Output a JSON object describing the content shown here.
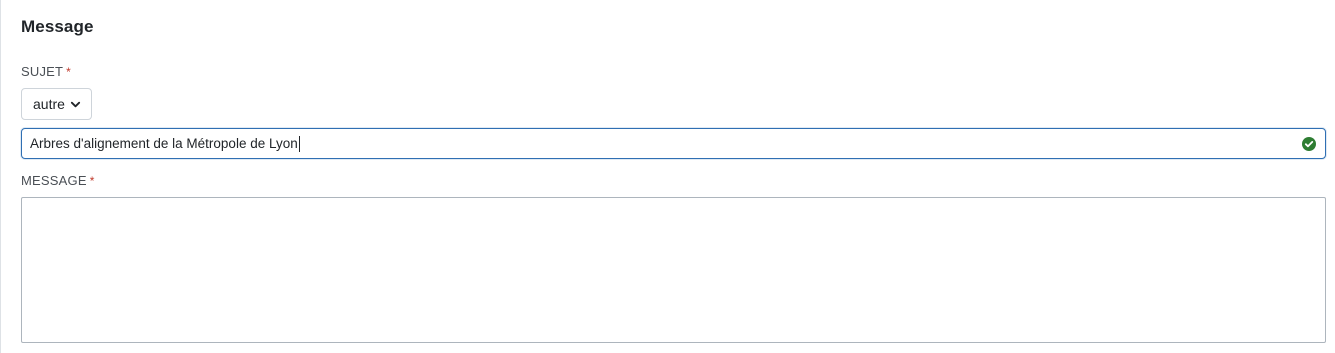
{
  "section": {
    "title": "Message"
  },
  "subject": {
    "label": "SUJET",
    "required_mark": "*",
    "select_value": "autre",
    "input_value": "Arbres d'alignement de la Métropole de Lyon",
    "valid_icon": "check-circle-icon"
  },
  "message": {
    "label": "MESSAGE",
    "required_mark": "*",
    "value": ""
  },
  "colors": {
    "focus_border": "#2f6fb3",
    "valid": "#2e7d32",
    "required": "#c0392b"
  }
}
